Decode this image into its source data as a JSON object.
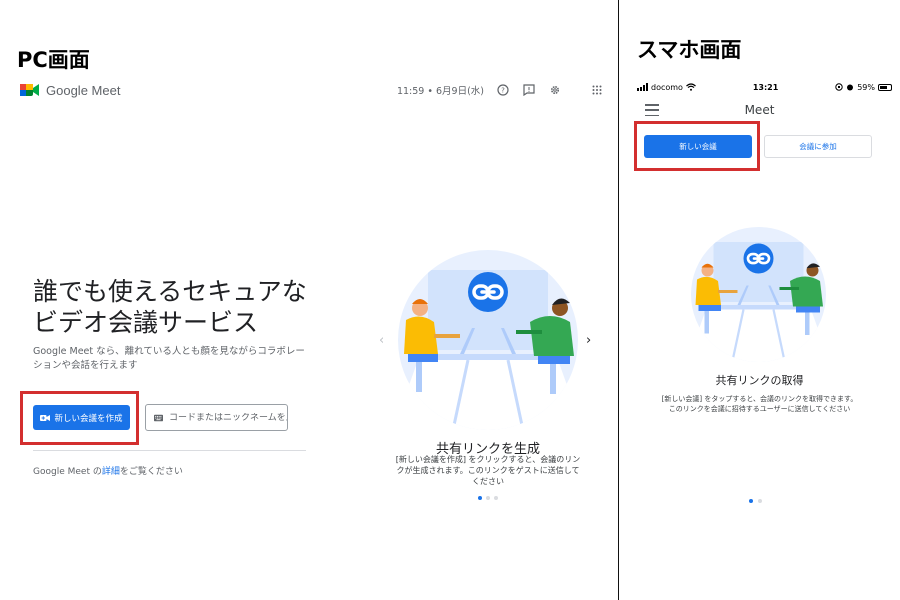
{
  "labels": {
    "pc": "PC画面",
    "sp": "スマホ画面"
  },
  "pc": {
    "logo_text": "Google Meet",
    "datetime": "11:59 • 6月9日(水)",
    "icons": [
      "help-icon",
      "feedback-icon",
      "settings-icon",
      "apps-icon"
    ],
    "hero_title_line1": "誰でも使えるセキュアな",
    "hero_title_line2": "ビデオ会議サービス",
    "hero_sub": "Google Meet なら、離れている人とも顔を見ながらコラボレーションや会話を行えます",
    "new_meeting_label": "新しい会議を作成",
    "code_placeholder": "コードまたはニックネームを入力",
    "learn_more_prefix": "Google Meet の",
    "learn_more_link": "詳細",
    "learn_more_suffix": "をご覧ください",
    "caption_title": "共有リンクを生成",
    "caption_body": "[新しい会議を作成] をクリックすると、会議のリンクが生成されます。このリンクをゲストに送信してください",
    "carousel_prev": "‹",
    "carousel_next": "›"
  },
  "sp": {
    "carrier": "docomo",
    "time": "13:21",
    "battery": "59%",
    "battery_level": 0.59,
    "title": "Meet",
    "new_meeting_label": "新しい会議",
    "join_label": "会議に参加",
    "caption_title": "共有リンクの取得",
    "caption_body_line1": "[新しい会議] をタップすると、会議のリンクを取得できます。",
    "caption_body_line2": "このリンクを会議に招待するユーザーに送信してください"
  },
  "colors": {
    "accent": "#1a73e8",
    "highlight": "#d32f2f"
  }
}
